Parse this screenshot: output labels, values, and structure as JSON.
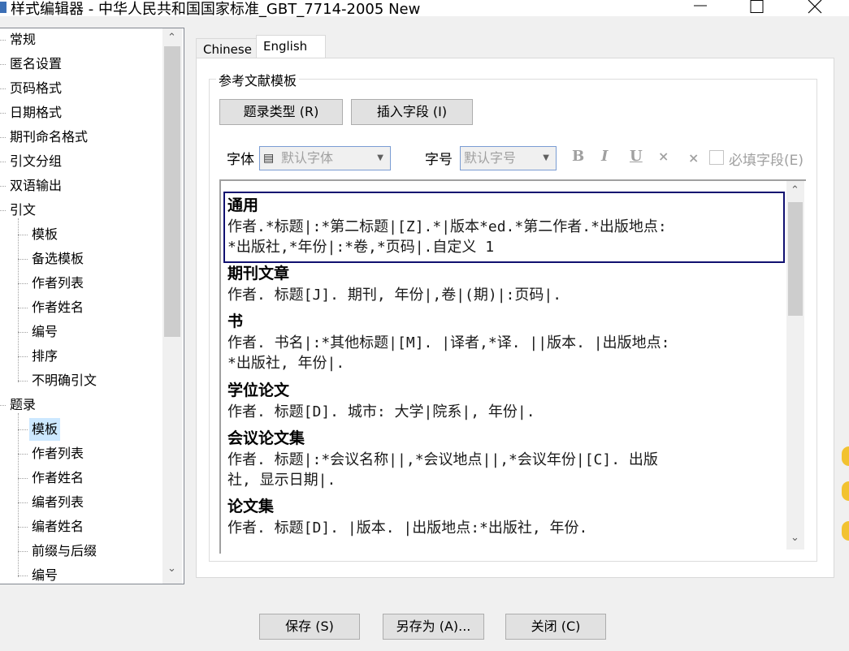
{
  "window": {
    "title": "样式编辑器 - 中华人民共和国国家标准_GBT_7714-2005 New"
  },
  "tree": {
    "items": [
      {
        "label": "常规",
        "level": 0
      },
      {
        "label": "匿名设置",
        "level": 0
      },
      {
        "label": "页码格式",
        "level": 0
      },
      {
        "label": "日期格式",
        "level": 0
      },
      {
        "label": "期刊命名格式",
        "level": 0
      },
      {
        "label": "引文分组",
        "level": 0
      },
      {
        "label": "双语输出",
        "level": 0
      },
      {
        "label": "引文",
        "level": 0
      },
      {
        "label": "模板",
        "level": 1
      },
      {
        "label": "备选模板",
        "level": 1
      },
      {
        "label": "作者列表",
        "level": 1
      },
      {
        "label": "作者姓名",
        "level": 1
      },
      {
        "label": "编号",
        "level": 1
      },
      {
        "label": "排序",
        "level": 1
      },
      {
        "label": "不明确引文",
        "level": 1
      },
      {
        "label": "题录",
        "level": 0
      },
      {
        "label": "模板",
        "level": 1,
        "selected": true
      },
      {
        "label": "作者列表",
        "level": 1
      },
      {
        "label": "作者姓名",
        "level": 1
      },
      {
        "label": "编者列表",
        "level": 1
      },
      {
        "label": "编者姓名",
        "level": 1
      },
      {
        "label": "前缀与后缀",
        "level": 1
      },
      {
        "label": "编号",
        "level": 1
      }
    ]
  },
  "tabs": [
    {
      "label": "Chinese",
      "active": false
    },
    {
      "label": "English",
      "active": true
    }
  ],
  "group": {
    "legend": "参考文献模板",
    "btn_type": "题录类型 (R)",
    "btn_insert": "插入字段 (I)",
    "font_label": "字体",
    "font_value": "默认字体",
    "size_label": "字号",
    "size_value": "默认字号",
    "bold": "B",
    "italic": "I",
    "underline": "U",
    "superscript": "×",
    "subscript": "×",
    "required_label": "必填字段(E)"
  },
  "entries": [
    {
      "title": "通用",
      "lines": [
        "作者.*标题|:*第二标题|[Z].*|版本*ed.*第二作者.*出版地点:",
        "*出版社,*年份|:*卷,*页码|.自定义 1"
      ]
    },
    {
      "title": "期刊文章",
      "lines": [
        "作者. 标题[J]. 期刊, 年份|,卷|(期)|:页码|."
      ]
    },
    {
      "title": "书",
      "lines": [
        "作者. 书名|:*其他标题|[M]. |译者,*译. ||版本. |出版地点:",
        "*出版社, 年份|."
      ]
    },
    {
      "title": "学位论文",
      "lines": [
        "作者. 标题[D]. 城市: 大学|院系|, 年份|."
      ]
    },
    {
      "title": "会议论文集",
      "lines": [
        "作者. 标题|:*会议名称||,*会议地点||,*会议年份|[C]. 出版",
        "社, 显示日期|."
      ]
    },
    {
      "title": "论文集",
      "lines": [
        "作者. 标题[D]. |版本. |出版地点:*出版社, 年份."
      ]
    }
  ],
  "footer": {
    "save": "保存 (S)",
    "save_as": "另存为 (A)...",
    "close": "关闭 (C)"
  },
  "colors": {
    "highlight_border": "#101070",
    "selected_item": "#cce8ff"
  }
}
